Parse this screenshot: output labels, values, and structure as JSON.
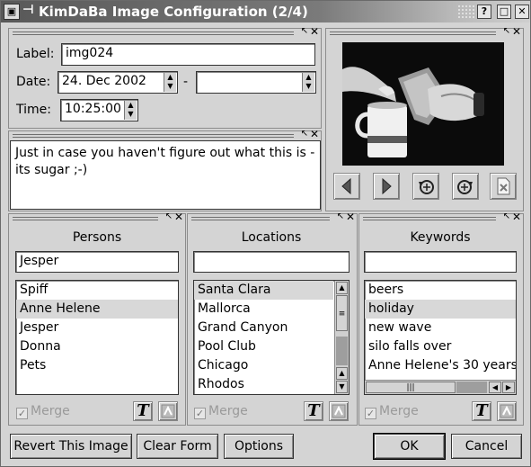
{
  "window": {
    "title": "KimDaBa Image Configuration (2/4)",
    "app_icon": "kimdaba-icon",
    "buttons": {
      "help": "?",
      "minimize": "_",
      "maximize": "□",
      "close": "✕"
    }
  },
  "dock": {
    "undock_glyph": "↖",
    "close_glyph": "✕"
  },
  "info": {
    "label_caption": "Label:",
    "label_value": "img024",
    "date_caption": "Date:",
    "date_value": "24. Dec 2002",
    "date_separator": "-",
    "date_end_value": "",
    "time_caption": "Time:",
    "time_value": "10:25:00"
  },
  "description": {
    "text": "Just in case you haven't figure out what this is - its sugar ;-)"
  },
  "viewer": {
    "nav": [
      "previous-icon",
      "next-icon",
      "rotate-left-icon",
      "rotate-right-icon",
      "delete-icon"
    ]
  },
  "persons": {
    "title": "Persons",
    "search_value": "Jesper",
    "items": [
      "Spiff",
      "Anne Helene",
      "Jesper",
      "Donna",
      "Pets"
    ],
    "selected_index": 1,
    "merge_label": "Merge"
  },
  "locations": {
    "title": "Locations",
    "search_value": "",
    "items": [
      "Santa Clara",
      "Mallorca",
      "Grand Canyon",
      "Pool Club",
      "Chicago",
      "Rhodos"
    ],
    "selected_index": 0,
    "merge_label": "Merge"
  },
  "keywords": {
    "title": "Keywords",
    "search_value": "",
    "items": [
      "beers",
      "holiday",
      "new wave",
      "silo falls over",
      "Anne Helene's 30 years"
    ],
    "selected_index": 1,
    "merge_label": "Merge"
  },
  "buttons": {
    "revert": "Revert This Image",
    "clear": "Clear Form",
    "options": "Options",
    "ok": "OK",
    "cancel": "Cancel"
  },
  "colors": {
    "selection": "#d8d8d8",
    "background": "#d4d4d4",
    "titlebar": "#585858"
  }
}
